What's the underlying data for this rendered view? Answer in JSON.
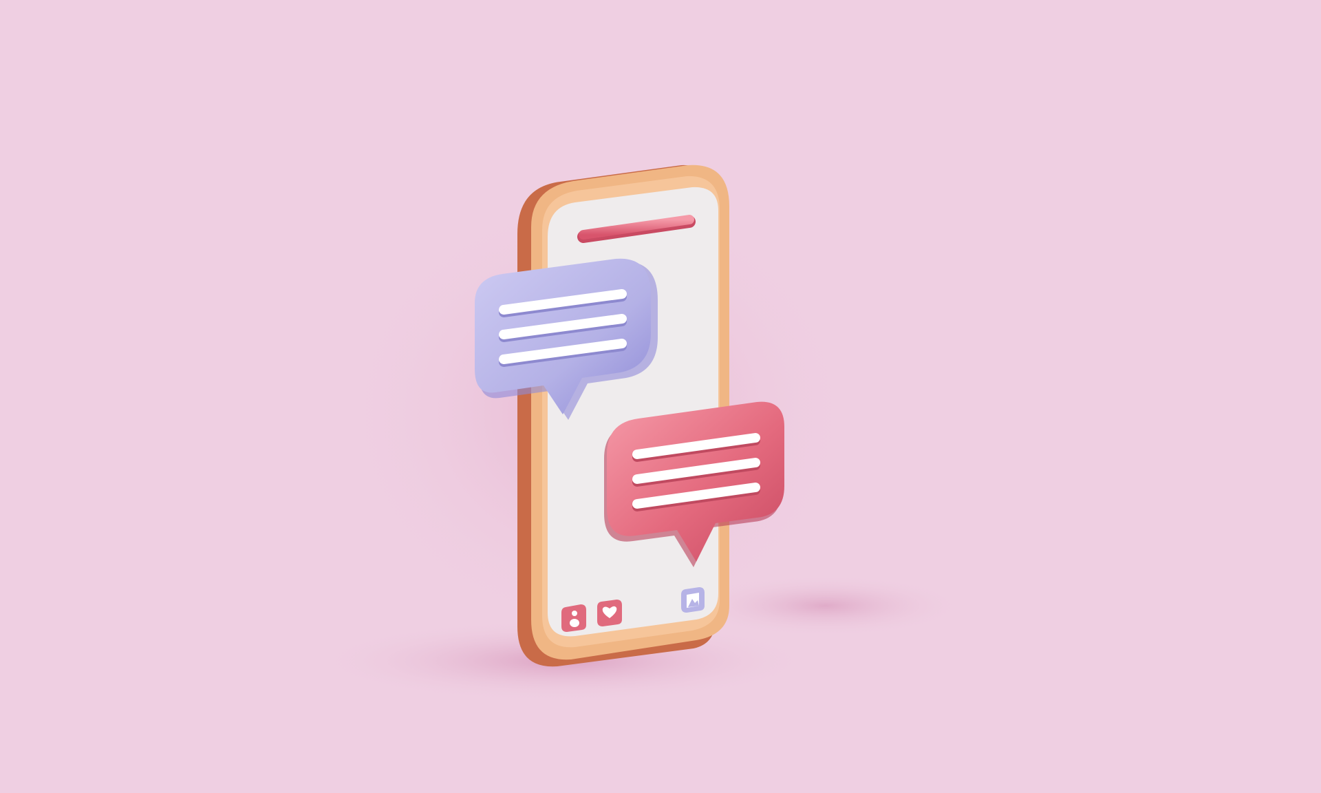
{
  "scene": {
    "subject": "phone-with-chat-bubbles",
    "background_color": "#efcfe2",
    "colors": {
      "phone_frame_outer": "#f0b684",
      "phone_frame_side": "#c96b48",
      "phone_screen": "#efeced",
      "status_bar": "#e4677a",
      "bubble_left": "#b6b3e6",
      "bubble_right": "#e06a7d",
      "text_lines": "#ffffff",
      "icon_accent_pink": "#e06a7d",
      "icon_accent_purple": "#b6b3e6"
    },
    "bubbles": [
      {
        "id": "incoming",
        "line_count": 3,
        "color": "#b6b3e6"
      },
      {
        "id": "outgoing",
        "line_count": 3,
        "color": "#e06a7d"
      }
    ],
    "bottom_icons": [
      "user-icon",
      "heart-icon",
      "image-icon"
    ]
  }
}
